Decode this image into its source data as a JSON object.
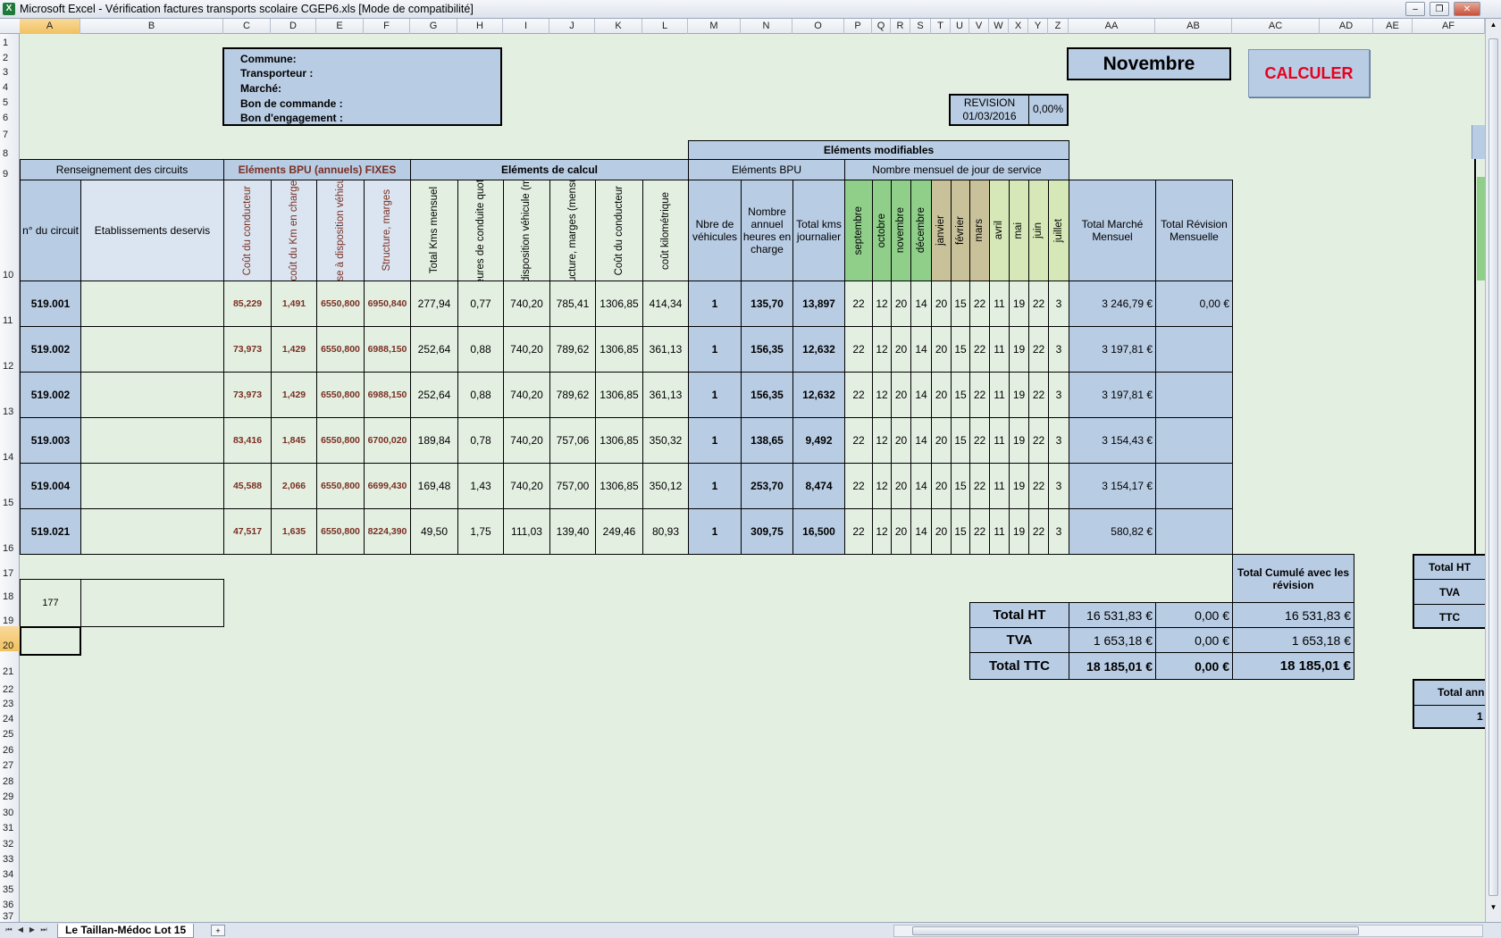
{
  "window": {
    "app_icon": "X",
    "title": "Microsoft Excel - Vérification factures transports scolaire CGEP6.xls  [Mode de compatibilité]",
    "minimize": "–",
    "restore": "❐",
    "close": "✕"
  },
  "columns": [
    "A",
    "B",
    "C",
    "D",
    "E",
    "F",
    "G",
    "H",
    "I",
    "J",
    "K",
    "L",
    "M",
    "N",
    "O",
    "P",
    "Q",
    "R",
    "S",
    "T",
    "U",
    "V",
    "W",
    "X",
    "Y",
    "Z",
    "AA",
    "AB",
    "AC",
    "AD",
    "AE",
    "AF"
  ],
  "rows": [
    "1",
    "2",
    "3",
    "4",
    "5",
    "6",
    "7",
    "8",
    "9",
    "10",
    "11",
    "12",
    "13",
    "14",
    "15",
    "16",
    "17",
    "18",
    "19",
    "20",
    "21",
    "22",
    "23",
    "24",
    "25",
    "26",
    "27",
    "28",
    "29",
    "30",
    "31",
    "32",
    "33",
    "34",
    "35",
    "36",
    "37"
  ],
  "info_box": {
    "commune": "Commune:",
    "transporteur": "Transporteur :",
    "marche": "Marché:",
    "bon_commande": "Bon de commande :",
    "bon_engagement": "Bon d'engagement :"
  },
  "month": "Novembre",
  "calc_button": "CALCULER",
  "revision": {
    "label": "REVISION",
    "date": "01/03/2016",
    "rate": "0,00%"
  },
  "sections": {
    "modifiable": "Eléments modifiables",
    "renseignement": "Renseignement des circuits",
    "bpu_fixes": "Eléments BPU (annuels) FIXES",
    "calcul": "Eléments de calcul",
    "bpu": "Eléments BPU",
    "jours": "Nombre mensuel de jour de service"
  },
  "headers": {
    "circuit": "n° du circuit",
    "etab": "Etablissements deservis",
    "cout_cond": "Coût du conducteur",
    "cout_km": "coût du Km en charge",
    "mise_dispo": "mise à disposition véhicule",
    "structure": "Structure, marges",
    "total_kms_mensuel": "Total Kms mensuel",
    "nbre_heures": "Nbre heures de conduite quotidienne",
    "mise_dispo_mensuel": "mise à disposition véhicule (mensuel)",
    "structure_mensuel": "Structure, marges (mensuel)",
    "cout_cond2": "Coût du conducteur",
    "cout_km2": "coût kilométrique",
    "nbre_vehicules": "Nbre de véhicules",
    "nombre_heures": "Nombre annuel heures en charge",
    "total_kms_jour": "Total kms journalier",
    "months": [
      "septembre",
      "octobre",
      "novembre",
      "décembre",
      "janvier",
      "février",
      "mars",
      "avril",
      "mai",
      "juin",
      "juillet"
    ],
    "total_marche": "Total Marché Mensuel",
    "total_revision": "Total Révision Mensuelle"
  },
  "data_rows": [
    {
      "circuit": "519.001",
      "cout_cond": "85,229",
      "cout_km": "1,491",
      "mise": "6550,800",
      "struct": "6950,840",
      "kms": "277,94",
      "heures": "0,77",
      "mise_m": "740,20",
      "struct_m": "785,41",
      "cond_m": "1306,85",
      "km_m": "414,34",
      "veh": "1",
      "h_annuel": "135,70",
      "kms_j": "13,897",
      "days": [
        "22",
        "12",
        "20",
        "14",
        "20",
        "15",
        "22",
        "11",
        "19",
        "22",
        "3"
      ],
      "total": "3 246,79 €",
      "revision": "0,00 €"
    },
    {
      "circuit": "519.002",
      "cout_cond": "73,973",
      "cout_km": "1,429",
      "mise": "6550,800",
      "struct": "6988,150",
      "kms": "252,64",
      "heures": "0,88",
      "mise_m": "740,20",
      "struct_m": "789,62",
      "cond_m": "1306,85",
      "km_m": "361,13",
      "veh": "1",
      "h_annuel": "156,35",
      "kms_j": "12,632",
      "days": [
        "22",
        "12",
        "20",
        "14",
        "20",
        "15",
        "22",
        "11",
        "19",
        "22",
        "3"
      ],
      "total": "3 197,81 €",
      "revision": ""
    },
    {
      "circuit": "519.002",
      "cout_cond": "73,973",
      "cout_km": "1,429",
      "mise": "6550,800",
      "struct": "6988,150",
      "kms": "252,64",
      "heures": "0,88",
      "mise_m": "740,20",
      "struct_m": "789,62",
      "cond_m": "1306,85",
      "km_m": "361,13",
      "veh": "1",
      "h_annuel": "156,35",
      "kms_j": "12,632",
      "days": [
        "22",
        "12",
        "20",
        "14",
        "20",
        "15",
        "22",
        "11",
        "19",
        "22",
        "3"
      ],
      "total": "3 197,81 €",
      "revision": ""
    },
    {
      "circuit": "519.003",
      "cout_cond": "83,416",
      "cout_km": "1,845",
      "mise": "6550,800",
      "struct": "6700,020",
      "kms": "189,84",
      "heures": "0,78",
      "mise_m": "740,20",
      "struct_m": "757,06",
      "cond_m": "1306,85",
      "km_m": "350,32",
      "veh": "1",
      "h_annuel": "138,65",
      "kms_j": "9,492",
      "days": [
        "22",
        "12",
        "20",
        "14",
        "20",
        "15",
        "22",
        "11",
        "19",
        "22",
        "3"
      ],
      "total": "3 154,43 €",
      "revision": ""
    },
    {
      "circuit": "519.004",
      "cout_cond": "45,588",
      "cout_km": "2,066",
      "mise": "6550,800",
      "struct": "6699,430",
      "kms": "169,48",
      "heures": "1,43",
      "mise_m": "740,20",
      "struct_m": "757,00",
      "cond_m": "1306,85",
      "km_m": "350,12",
      "veh": "1",
      "h_annuel": "253,70",
      "kms_j": "8,474",
      "days": [
        "22",
        "12",
        "20",
        "14",
        "20",
        "15",
        "22",
        "11",
        "19",
        "22",
        "3"
      ],
      "total": "3 154,17 €",
      "revision": ""
    },
    {
      "circuit": "519.021",
      "cout_cond": "47,517",
      "cout_km": "1,635",
      "mise": "6550,800",
      "struct": "8224,390",
      "kms": "49,50",
      "heures": "1,75",
      "mise_m": "111,03",
      "struct_m": "139,40",
      "cond_m": "249,46",
      "km_m": "80,93",
      "veh": "1",
      "h_annuel": "309,75",
      "kms_j": "16,500",
      "days": [
        "22",
        "12",
        "20",
        "14",
        "20",
        "15",
        "22",
        "11",
        "19",
        "22",
        "3"
      ],
      "total": "580,82 €",
      "revision": ""
    }
  ],
  "a18_value": "177",
  "totals": {
    "cumul_header": "Total Cumulé avec les révision",
    "rows": [
      {
        "label": "Total HT",
        "marche": "16 531,83 €",
        "revision": "0,00 €",
        "cumul": "16 531,83 €"
      },
      {
        "label": "TVA",
        "marche": "1 653,18 €",
        "revision": "0,00 €",
        "cumul": "1 653,18 €"
      },
      {
        "label": "Total TTC",
        "marche": "18 185,01 €",
        "revision": "0,00 €",
        "cumul": "18 185,01 €"
      }
    ]
  },
  "side_totals": {
    "ht": "Total HT",
    "tva": "TVA",
    "ttc": "TTC",
    "annual": "Total ann",
    "annual_val": "1"
  },
  "sheet_tab": "Le Taillan-Médoc Lot 15",
  "colors": {
    "header_blue": "#b8cce4",
    "sheet_bg": "#e3efe1",
    "autumn": "#8fcf8a",
    "winter": "#c9c19a",
    "spring": "#d6e8b8",
    "calc_red": "#e8001c"
  }
}
